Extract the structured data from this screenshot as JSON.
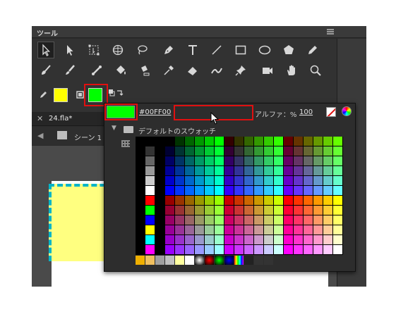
{
  "panel": {
    "title": "ツール"
  },
  "document": {
    "tab_label": "24.fla*",
    "scene_label": "シーン 1"
  },
  "colors": {
    "stroke": "#ffff00",
    "fill": "#00ff00",
    "highlight": "#e01010",
    "panel_bg": "#2b2b2b"
  },
  "tools": {
    "row1": [
      "selection-arrow-icon",
      "subselection-icon",
      "free-transform-icon",
      "3d-rotation-icon",
      "lasso-icon",
      "pen-icon",
      "text-icon",
      "line-icon",
      "rectangle-icon",
      "oval-icon",
      "polystar-icon",
      "pencil-icon"
    ],
    "row2": [
      "paint-brush-icon",
      "brush-icon",
      "bone-icon",
      "paint-bucket-icon",
      "ink-bottle-icon",
      "eyedropper-icon",
      "eraser-icon",
      "width-tool-icon",
      "pin-icon",
      "camera-icon",
      "hand-icon",
      "zoom-icon"
    ]
  },
  "swatch_panel": {
    "hex_value": "#00FF00",
    "alpha_label": "アルファ：%",
    "alpha_value": "100",
    "folder_label": "デフォルトのスウォッチ",
    "current_color": "#00ff00"
  }
}
